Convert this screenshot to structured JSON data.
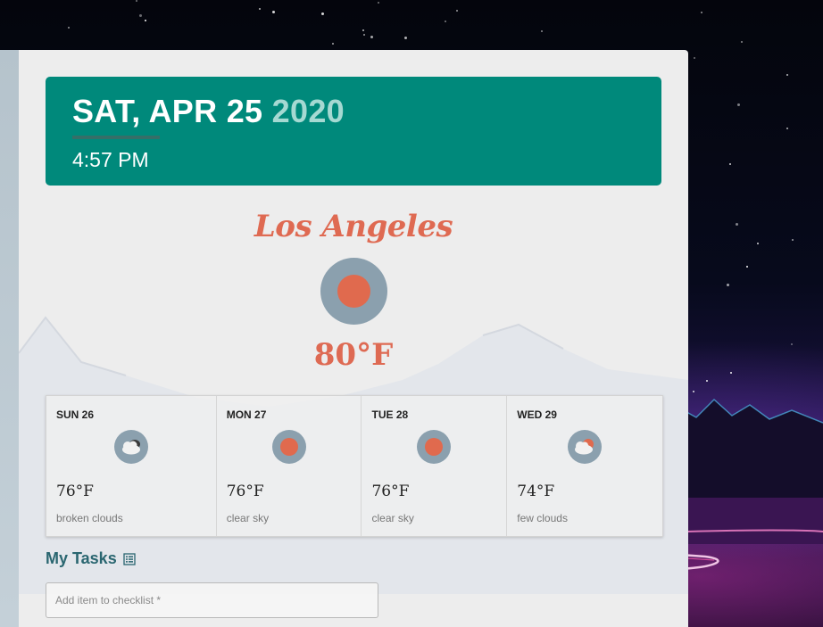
{
  "header": {
    "date": "SAT, APR 25",
    "year": "2020",
    "time": "4:57 PM"
  },
  "current": {
    "city": "Los Angeles",
    "temp": "80°F",
    "icon": "clear-sky-icon"
  },
  "forecast": [
    {
      "day": "SUN 26",
      "temp": "76°F",
      "desc": "broken clouds",
      "icon": "broken-clouds-icon"
    },
    {
      "day": "MON 27",
      "temp": "76°F",
      "desc": "clear sky",
      "icon": "clear-sky-icon"
    },
    {
      "day": "TUE 28",
      "temp": "76°F",
      "desc": "clear sky",
      "icon": "clear-sky-icon"
    },
    {
      "day": "WED 29",
      "temp": "74°F",
      "desc": "few clouds",
      "icon": "few-clouds-icon"
    }
  ],
  "tasks": {
    "title": "My Tasks",
    "input_placeholder": "Add item to checklist *"
  },
  "colors": {
    "header_bg": "#00897b",
    "accent": "#df6a52",
    "icon_bg": "#8ba0ae",
    "tasks_title": "#2a6670"
  }
}
